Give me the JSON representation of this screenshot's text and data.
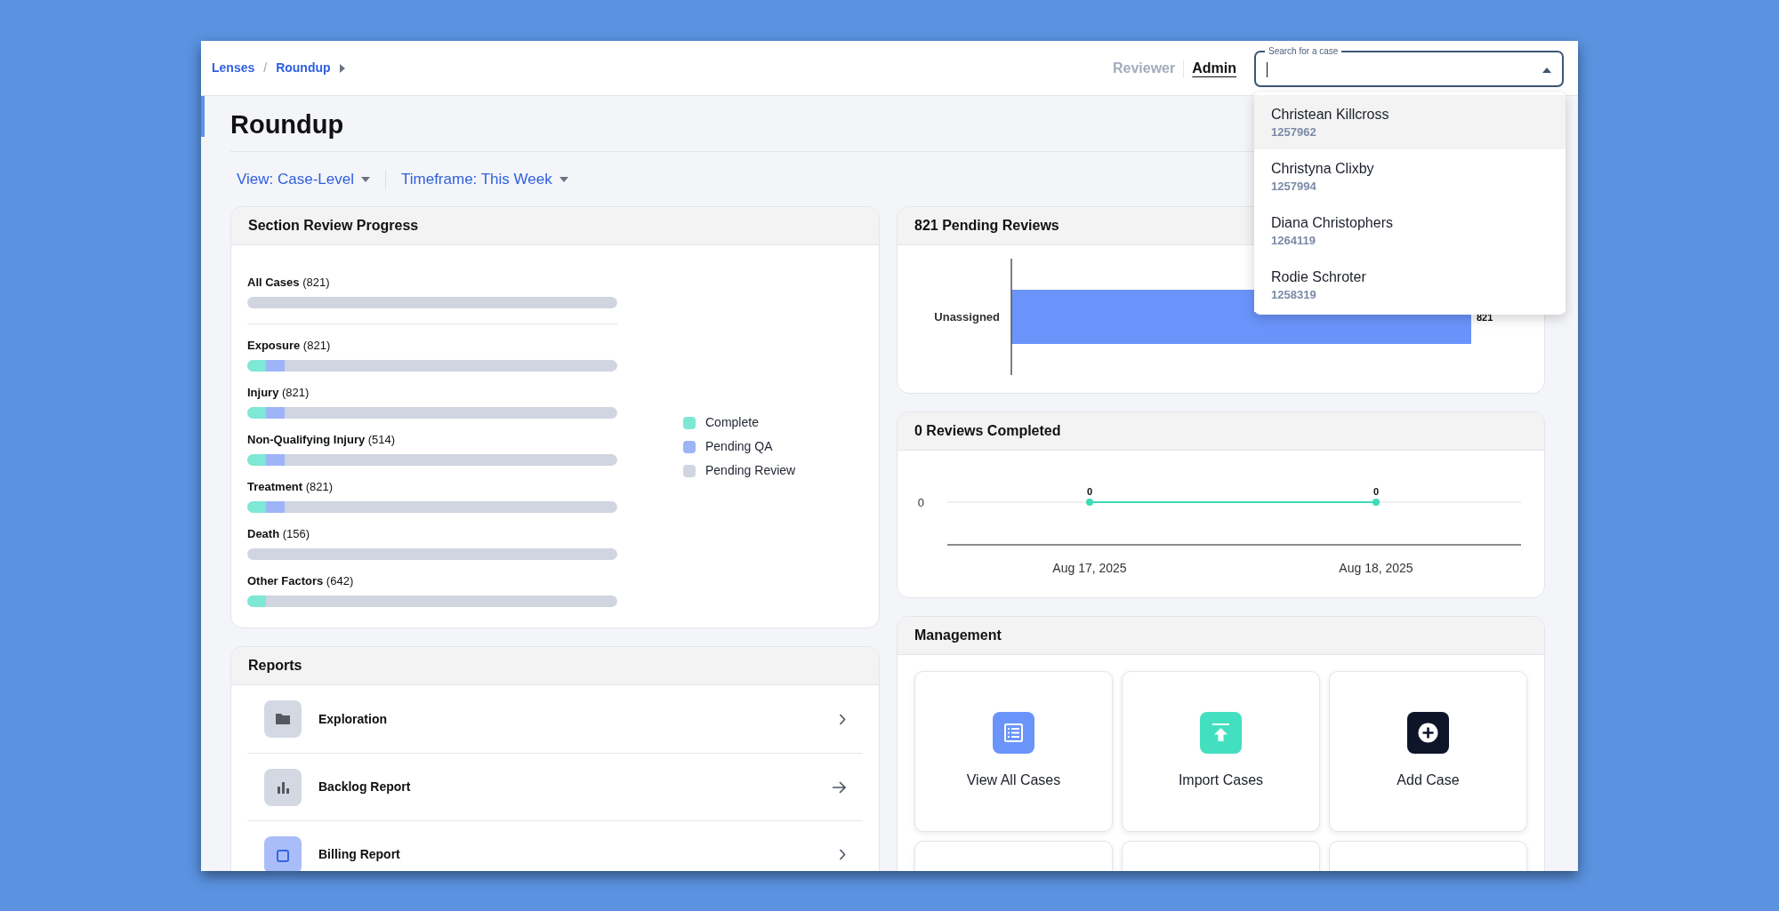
{
  "breadcrumb": [
    "Lenses",
    "Roundup"
  ],
  "breadcrumb_separator": "/",
  "roles": [
    {
      "label": "Reviewer",
      "selected": false
    },
    {
      "label": "Admin",
      "selected": true
    }
  ],
  "search": {
    "label": "Search for a case",
    "expanded": true,
    "results": [
      {
        "name": "Christean Killcross",
        "id": "1257962",
        "selected": true
      },
      {
        "name": "Christyna Clixby",
        "id": "1257994",
        "selected": false
      },
      {
        "name": "Diana Christophers",
        "id": "1264119",
        "selected": false
      },
      {
        "name": "Rodie Schroter",
        "id": "1258319",
        "selected": false
      }
    ]
  },
  "page_title": "Roundup",
  "filters": [
    "View: Case-Level",
    "Timeframe: This Week"
  ],
  "section_progress": {
    "title": "Section Review Progress",
    "sections": [
      {
        "name": "All Cases",
        "count": "(821)"
      },
      {
        "name": "Exposure",
        "count": "(821)",
        "segments": [
          {
            "kind": "complete",
            "level": 0.05
          },
          {
            "kind": "pending_qa",
            "level": 0.052
          }
        ]
      },
      {
        "name": "Injury",
        "count": "(821)",
        "segments": [
          {
            "kind": "complete",
            "level": 0.05
          },
          {
            "kind": "pending_qa",
            "level": 0.052
          }
        ]
      },
      {
        "name": "Non-Qualifying Injury",
        "count": "(514)",
        "segments": [
          {
            "kind": "complete",
            "level": 0.05
          },
          {
            "kind": "pending_qa",
            "level": 0.052
          }
        ]
      },
      {
        "name": "Treatment",
        "count": "(821)",
        "segments": [
          {
            "kind": "complete",
            "level": 0.05
          },
          {
            "kind": "pending_qa",
            "level": 0.052
          }
        ]
      },
      {
        "name": "Death",
        "count": "(156)"
      },
      {
        "name": "Other Factors",
        "count": "(642)",
        "segments": [
          {
            "kind": "complete",
            "level": 0.05
          }
        ]
      }
    ],
    "legend": [
      {
        "kind": "complete",
        "label": "Complete",
        "color": "#7de8d4"
      },
      {
        "kind": "pending_qa",
        "label": "Pending QA",
        "color": "#9db4f7"
      },
      {
        "kind": "pending_review",
        "label": "Pending Review",
        "color": "#d0d5e0"
      }
    ]
  },
  "pending_reviews": {
    "title": "821 Pending Reviews",
    "bars": [
      {
        "label": "Unassigned",
        "value": "821"
      }
    ]
  },
  "reviews_completed": {
    "title": "0 Reviews Completed",
    "y_axis_labels": [
      "0"
    ],
    "points": [
      {
        "value": "0"
      },
      {
        "value": "0"
      }
    ],
    "x_labels": [
      "Aug 17, 2025",
      "Aug 18, 2025"
    ]
  },
  "reports": {
    "title": "Reports",
    "items": [
      {
        "label": "Exploration",
        "kind": "folder"
      },
      {
        "label": "Backlog Report",
        "kind": "chart"
      },
      {
        "label": "Billing Report",
        "kind": "billing"
      }
    ]
  },
  "management": {
    "title": "Management",
    "items": [
      {
        "label": "View All Cases",
        "kind": "list"
      },
      {
        "label": "Import Cases",
        "kind": "import"
      },
      {
        "label": "Add Case",
        "kind": "add"
      },
      {
        "kind": "empty"
      },
      {
        "kind": "empty"
      },
      {
        "kind": "empty"
      }
    ]
  }
}
